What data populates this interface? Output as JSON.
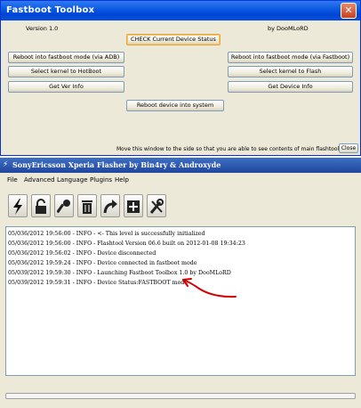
{
  "toolbox": {
    "title": "Fastboot Toolbox",
    "version": "Version 1.0",
    "author": "by DooMLoRD",
    "buttons": {
      "check_status": "CHECK Current Device Status",
      "reboot_fastboot_adb": "Reboot into fastboot mode (via ADB)",
      "reboot_fastboot_fastboot": "Reboot into fastboot mode (via Fastboot)",
      "select_kernel_hotboot": "Select kernel to HotBoot",
      "select_kernel_flash": "Select kernel to Flash",
      "get_ver_info": "Get Ver Info",
      "get_device_info": "Get Device Info",
      "reboot_system": "Reboot device into system",
      "close": "Close"
    },
    "hint": "Move this window to the side so that you are able to see contents of main flashtool log."
  },
  "flasher": {
    "title": "SonyEricsson Xperia Flasher by Bin4ry & Androxyde",
    "menu": [
      "File",
      "Advanced",
      "Language",
      "Plugins",
      "Help"
    ],
    "toolbar_icons": [
      "flash-icon",
      "unlock-icon",
      "key-icon",
      "trash-icon",
      "redo-icon",
      "plus-icon",
      "tools-icon"
    ],
    "log": [
      "05/036/2012 19:56:00 - INFO - <- This level is successfully initialized",
      "05/036/2012 19:56:00 - INFO - Flashtool Version 06.6 built on 2012-01-08 19:34:23",
      "05/036/2012 19:56:02 - INFO - Device disconnected",
      "05/036/2012 19:59:24 - INFO - Device connected in fastboot mode",
      "05/039/2012 19:59:30 - INFO - Launching Fastboot Toolbox 1.0 by DooMLoRD",
      "05/039/2012 19:59:31 - INFO - Device Status:FASTBOOT mode"
    ]
  }
}
